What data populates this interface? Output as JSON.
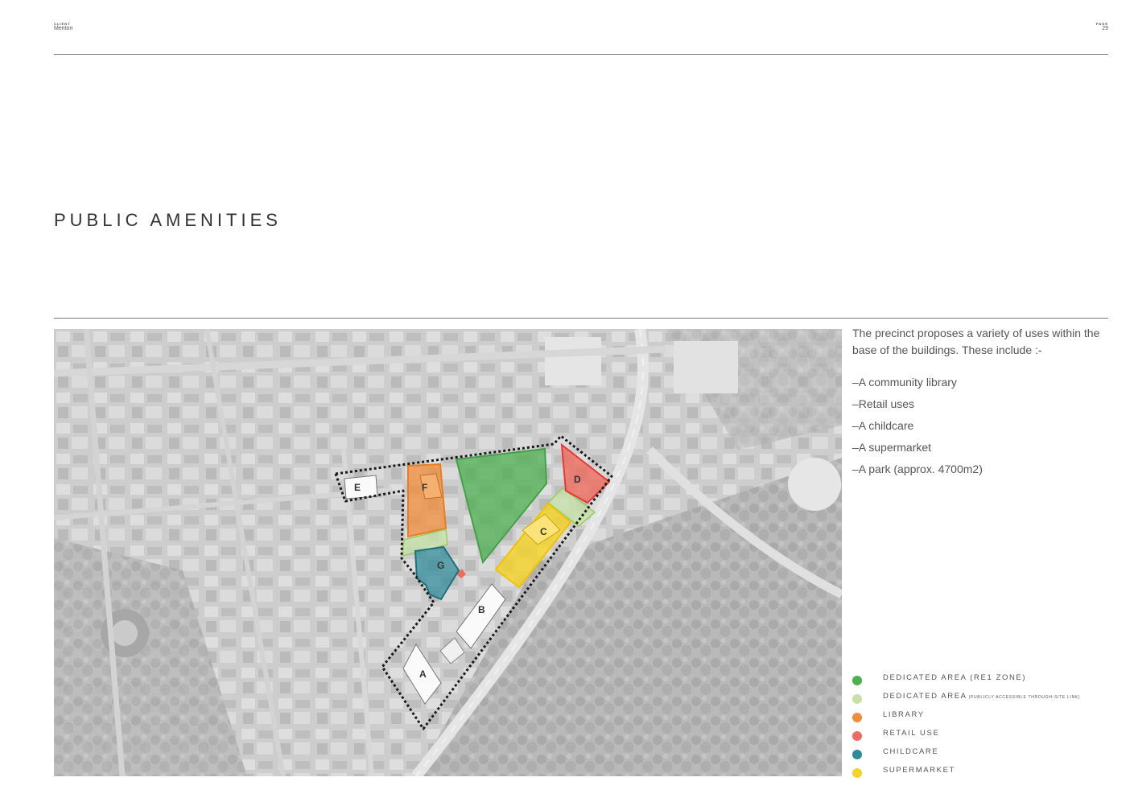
{
  "header": {
    "client_label": "CLIENT",
    "client_value": "Meriton",
    "page_label": "PAGE",
    "page_value": "29"
  },
  "title": "PUBLIC AMENITIES",
  "map": {
    "building_labels": [
      "A",
      "B",
      "C",
      "D",
      "E",
      "F",
      "G"
    ]
  },
  "description": {
    "intro": "The precinct proposes a variety of uses within the base of the buildings. These include :-",
    "items": [
      "–A community library",
      "–Retail uses",
      "–A childcare",
      "–A supermarket",
      "–A park (approx. 4700m2)"
    ]
  },
  "legend": [
    {
      "label": "DEDICATED AREA (RE1 ZONE)",
      "sub": "",
      "color": "#4CAF50"
    },
    {
      "label": "DEDICATED AREA",
      "sub": "(PUBLICLY ACCESSIBLE THROUGH-SITE LINK)",
      "color": "#C5E1A5"
    },
    {
      "label": "LIBRARY",
      "sub": "",
      "color": "#F28C38"
    },
    {
      "label": "RETAIL USE",
      "sub": "",
      "color": "#EE6B5F"
    },
    {
      "label": "CHILDCARE",
      "sub": "",
      "color": "#2E8B9A"
    },
    {
      "label": "SUPERMARKET",
      "sub": "",
      "color": "#F5D327"
    }
  ]
}
